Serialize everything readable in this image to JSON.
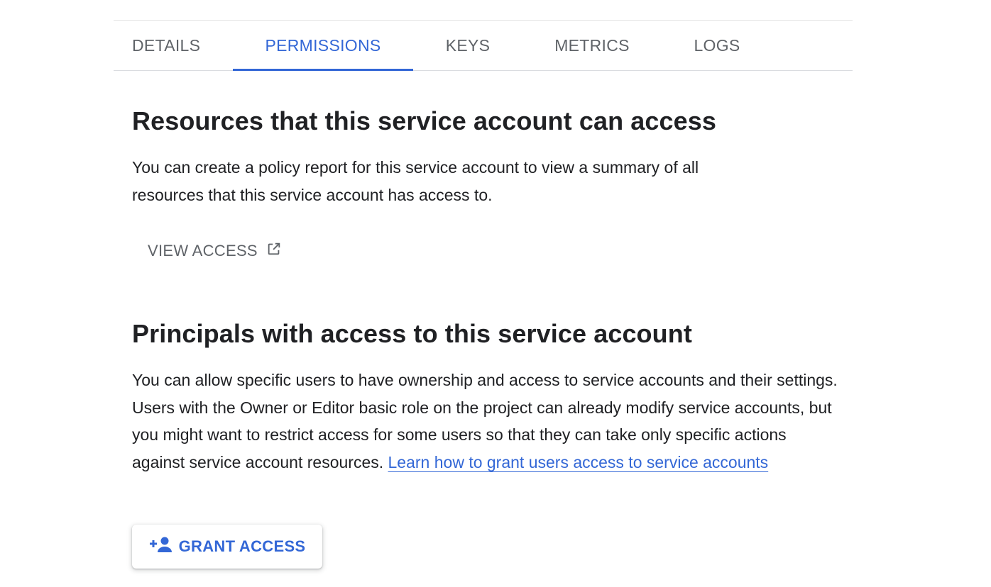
{
  "tabs": [
    {
      "label": "DETAILS",
      "active": false
    },
    {
      "label": "PERMISSIONS",
      "active": true
    },
    {
      "label": "KEYS",
      "active": false
    },
    {
      "label": "METRICS",
      "active": false
    },
    {
      "label": "LOGS",
      "active": false
    }
  ],
  "resources_section": {
    "title": "Resources that this service account can access",
    "description": "You can create a policy report for this service account to view a summary of all resources that this service account has access to.",
    "view_access_label": "VIEW ACCESS",
    "view_access_icon": "open-in-new-icon"
  },
  "principals_section": {
    "title": "Principals with access to this service account",
    "description": "You can allow specific users to have ownership and access to service accounts and their settings. Users with the Owner or Editor basic role on the project can already modify service accounts, but you might want to restrict access for some users so that they can take only specific actions against service account resources.",
    "learn_link": "Learn how to grant users access to service accounts",
    "grant_access_label": "GRANT ACCESS",
    "grant_access_icon": "person-add-icon"
  },
  "colors": {
    "accent": "#3367d6",
    "tab_inactive": "#5f6368",
    "text": "#202124"
  }
}
